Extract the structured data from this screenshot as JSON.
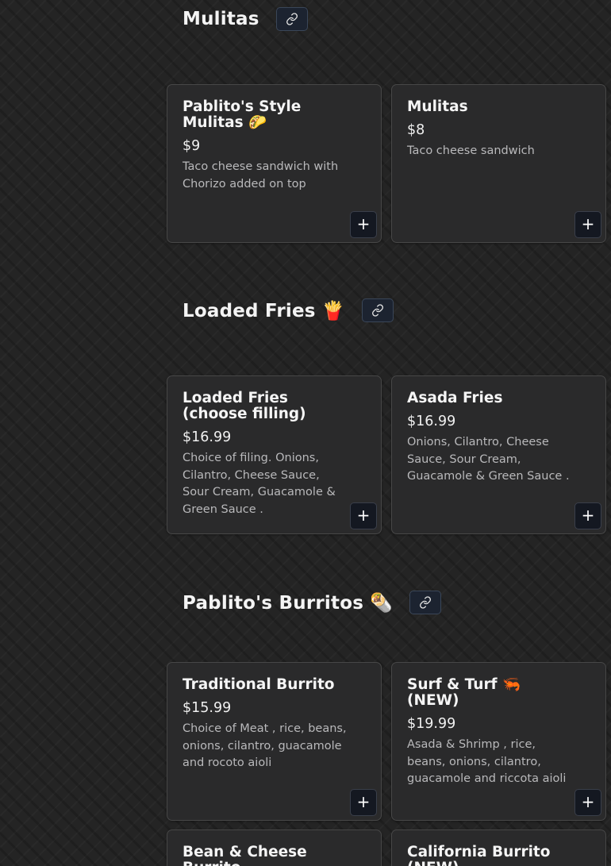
{
  "sections": [
    {
      "title": "Mulitas",
      "items": [
        {
          "name": "Pablito's Style Mulitas 🌮",
          "price": "$9",
          "description": "Taco cheese sandwich with Chorizo added on top"
        },
        {
          "name": "Mulitas",
          "price": "$8",
          "description": "Taco cheese sandwich"
        }
      ]
    },
    {
      "title": "Loaded Fries 🍟",
      "items": [
        {
          "name": "Loaded Fries (choose filling)",
          "price": "$16.99",
          "description": "Choice of filing. Onions, Cilantro, Cheese Sauce, Sour Cream, Guacamole & Green Sauce ."
        },
        {
          "name": "Asada Fries",
          "price": "$16.99",
          "description": "Onions, Cilantro, Cheese Sauce, Sour Cream, Guacamole & Green Sauce ."
        }
      ]
    },
    {
      "title": "Pablito's Burritos 🌯",
      "items": [
        {
          "name": "Traditional Burrito",
          "price": "$15.99",
          "description": "Choice of Meat , rice, beans, onions, cilantro, guacamole and rocoto aioli"
        },
        {
          "name": "Surf & Turf 🦐 (NEW)",
          "price": "$19.99",
          "description": "Asada & Shrimp , rice, beans, onions, cilantro, guacamole and riccota aioli"
        },
        {
          "name": "Bean & Cheese Burrito",
          "price": "",
          "description": ""
        },
        {
          "name": "California Burrito (NEW)",
          "price": "",
          "description": ""
        }
      ]
    }
  ],
  "add_button_label": "+",
  "icons": {
    "link": "link-icon",
    "add": "plus-icon"
  },
  "colors": {
    "background": "#242424",
    "card": "#2a2a2b",
    "button": "#141821"
  }
}
